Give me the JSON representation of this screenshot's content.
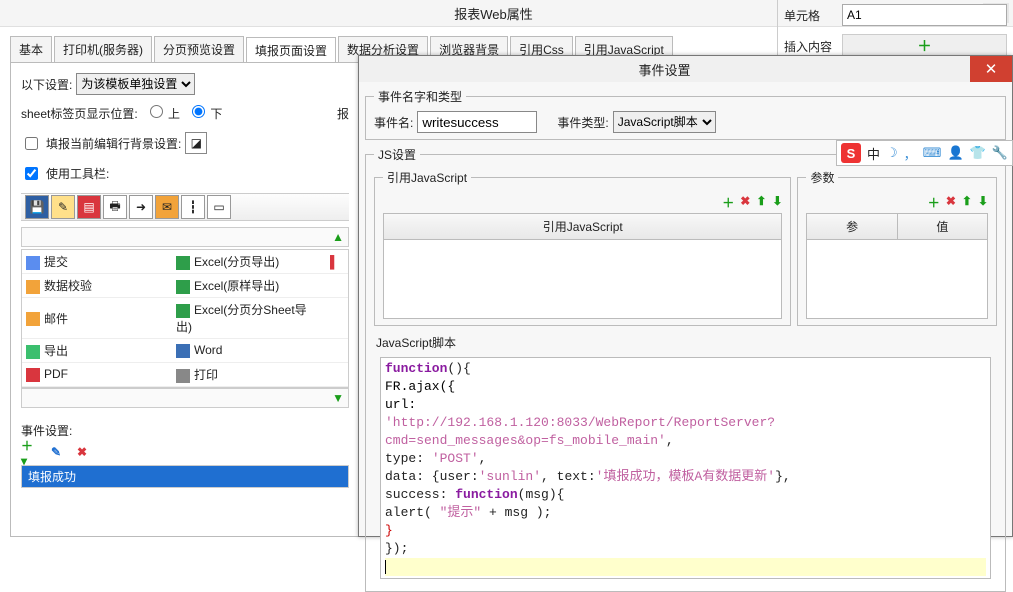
{
  "main_dialog": {
    "title": "报表Web属性",
    "tabs": [
      "基本",
      "打印机(服务器)",
      "分页预览设置",
      "填报页面设置",
      "数据分析设置",
      "浏览器背景",
      "引用Css",
      "引用JavaScript"
    ],
    "active_tab_index": 3,
    "below_label": "以下设置:",
    "below_combo": "为该模板单独设置",
    "sheet_pos_label": "sheet标签页显示位置:",
    "sheet_pos_up": "上",
    "sheet_pos_down": "下",
    "fill_bg_label": "填报当前编辑行背景设置:",
    "use_toolbar_label": "使用工具栏:",
    "export_title_cut": "报",
    "left_actions": [
      {
        "icon": "ic-submit",
        "label": "提交"
      },
      {
        "icon": "ic-valid",
        "label": "数据校验"
      },
      {
        "icon": "ic-mail",
        "label": "邮件"
      },
      {
        "icon": "ic-export",
        "label": "导出"
      },
      {
        "icon": "ic-pdf",
        "label": "PDF"
      }
    ],
    "right_actions": [
      {
        "icon": "ic-excel",
        "label": "Excel(分页导出)"
      },
      {
        "icon": "ic-excel",
        "label": "Excel(原样导出)"
      },
      {
        "icon": "ic-excel",
        "label": "Excel(分页分Sheet导出)"
      },
      {
        "icon": "ic-word",
        "label": "Word"
      },
      {
        "icon": "ic-print",
        "label": "打印"
      }
    ],
    "event_section": "事件设置:",
    "event_items": [
      "填报成功"
    ]
  },
  "right_strip": {
    "cell_label": "单元格",
    "cell_value": "A1",
    "insert_label": "插入内容"
  },
  "event_dialog": {
    "title": "事件设置",
    "name_type_legend": "事件名字和类型",
    "name_label": "事件名:",
    "name_value": "writesuccess",
    "type_label": "事件类型:",
    "type_value": "JavaScript脚本",
    "js_legend": "JS设置",
    "ref_js_legend": "引用JavaScript",
    "ref_js_header": "引用JavaScript",
    "param_legend": "参数",
    "param_col1": "参",
    "param_col2": "值",
    "script_label": "JavaScript脚本",
    "code": {
      "l1a": "function",
      "l1b": "(){",
      "l2": "FR.ajax({",
      "l3": "url:",
      "l4": "'http://192.168.1.120:8033/WebReport/ReportServer?cmd=send_messages&op=fs_mobile_main'",
      "l4b": ",",
      "l5a": "type: ",
      "l5b": "'POST'",
      "l5c": ",",
      "l6a": "data: {user:",
      "l6b": "'sunlin'",
      "l6c": ", text:",
      "l6d": "'填报成功，模板A有数据更新'",
      "l6e": "},",
      "l7a": "success: ",
      "l7b": "function",
      "l7c": "(msg){",
      "l8a": "alert( ",
      "l8b": "\"提示\"",
      "l8c": " + msg );",
      "l9": "}",
      "l10": "});"
    }
  },
  "ime": {
    "label": "中"
  }
}
